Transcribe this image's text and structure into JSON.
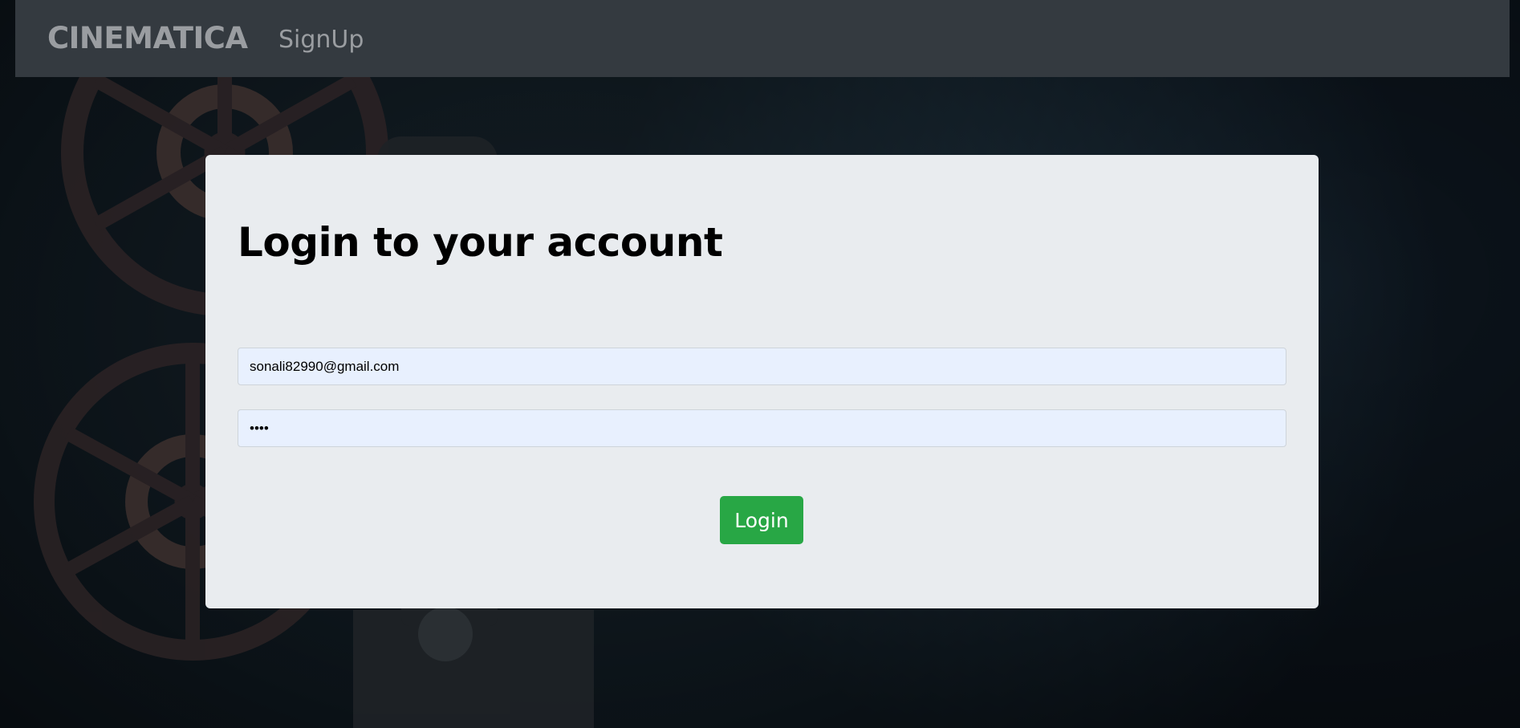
{
  "navbar": {
    "brand": "CINEMATICA",
    "signup_label": "SignUp"
  },
  "login_card": {
    "heading": "Login to your account",
    "email_value": "sonali82990@gmail.com",
    "password_value": "1234",
    "login_button_label": "Login"
  },
  "colors": {
    "navbar_bg": "#343a40",
    "card_bg": "#e9ecef",
    "input_bg": "#e8f0fe",
    "login_button": "#28a745"
  },
  "background": {
    "image_subject": "film-projector-icon"
  }
}
